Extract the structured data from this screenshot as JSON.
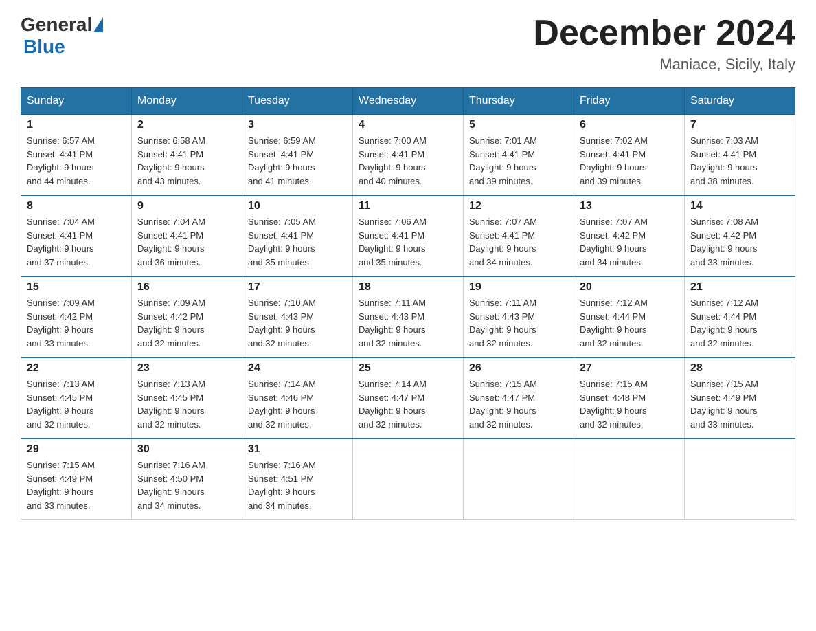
{
  "header": {
    "logo": {
      "general": "General",
      "blue": "Blue"
    },
    "month_title": "December 2024",
    "location": "Maniace, Sicily, Italy"
  },
  "weekdays": [
    "Sunday",
    "Monday",
    "Tuesday",
    "Wednesday",
    "Thursday",
    "Friday",
    "Saturday"
  ],
  "weeks": [
    [
      {
        "day": "1",
        "sunrise": "6:57 AM",
        "sunset": "4:41 PM",
        "daylight": "9 hours and 44 minutes."
      },
      {
        "day": "2",
        "sunrise": "6:58 AM",
        "sunset": "4:41 PM",
        "daylight": "9 hours and 43 minutes."
      },
      {
        "day": "3",
        "sunrise": "6:59 AM",
        "sunset": "4:41 PM",
        "daylight": "9 hours and 41 minutes."
      },
      {
        "day": "4",
        "sunrise": "7:00 AM",
        "sunset": "4:41 PM",
        "daylight": "9 hours and 40 minutes."
      },
      {
        "day": "5",
        "sunrise": "7:01 AM",
        "sunset": "4:41 PM",
        "daylight": "9 hours and 39 minutes."
      },
      {
        "day": "6",
        "sunrise": "7:02 AM",
        "sunset": "4:41 PM",
        "daylight": "9 hours and 39 minutes."
      },
      {
        "day": "7",
        "sunrise": "7:03 AM",
        "sunset": "4:41 PM",
        "daylight": "9 hours and 38 minutes."
      }
    ],
    [
      {
        "day": "8",
        "sunrise": "7:04 AM",
        "sunset": "4:41 PM",
        "daylight": "9 hours and 37 minutes."
      },
      {
        "day": "9",
        "sunrise": "7:04 AM",
        "sunset": "4:41 PM",
        "daylight": "9 hours and 36 minutes."
      },
      {
        "day": "10",
        "sunrise": "7:05 AM",
        "sunset": "4:41 PM",
        "daylight": "9 hours and 35 minutes."
      },
      {
        "day": "11",
        "sunrise": "7:06 AM",
        "sunset": "4:41 PM",
        "daylight": "9 hours and 35 minutes."
      },
      {
        "day": "12",
        "sunrise": "7:07 AM",
        "sunset": "4:41 PM",
        "daylight": "9 hours and 34 minutes."
      },
      {
        "day": "13",
        "sunrise": "7:07 AM",
        "sunset": "4:42 PM",
        "daylight": "9 hours and 34 minutes."
      },
      {
        "day": "14",
        "sunrise": "7:08 AM",
        "sunset": "4:42 PM",
        "daylight": "9 hours and 33 minutes."
      }
    ],
    [
      {
        "day": "15",
        "sunrise": "7:09 AM",
        "sunset": "4:42 PM",
        "daylight": "9 hours and 33 minutes."
      },
      {
        "day": "16",
        "sunrise": "7:09 AM",
        "sunset": "4:42 PM",
        "daylight": "9 hours and 32 minutes."
      },
      {
        "day": "17",
        "sunrise": "7:10 AM",
        "sunset": "4:43 PM",
        "daylight": "9 hours and 32 minutes."
      },
      {
        "day": "18",
        "sunrise": "7:11 AM",
        "sunset": "4:43 PM",
        "daylight": "9 hours and 32 minutes."
      },
      {
        "day": "19",
        "sunrise": "7:11 AM",
        "sunset": "4:43 PM",
        "daylight": "9 hours and 32 minutes."
      },
      {
        "day": "20",
        "sunrise": "7:12 AM",
        "sunset": "4:44 PM",
        "daylight": "9 hours and 32 minutes."
      },
      {
        "day": "21",
        "sunrise": "7:12 AM",
        "sunset": "4:44 PM",
        "daylight": "9 hours and 32 minutes."
      }
    ],
    [
      {
        "day": "22",
        "sunrise": "7:13 AM",
        "sunset": "4:45 PM",
        "daylight": "9 hours and 32 minutes."
      },
      {
        "day": "23",
        "sunrise": "7:13 AM",
        "sunset": "4:45 PM",
        "daylight": "9 hours and 32 minutes."
      },
      {
        "day": "24",
        "sunrise": "7:14 AM",
        "sunset": "4:46 PM",
        "daylight": "9 hours and 32 minutes."
      },
      {
        "day": "25",
        "sunrise": "7:14 AM",
        "sunset": "4:47 PM",
        "daylight": "9 hours and 32 minutes."
      },
      {
        "day": "26",
        "sunrise": "7:15 AM",
        "sunset": "4:47 PM",
        "daylight": "9 hours and 32 minutes."
      },
      {
        "day": "27",
        "sunrise": "7:15 AM",
        "sunset": "4:48 PM",
        "daylight": "9 hours and 32 minutes."
      },
      {
        "day": "28",
        "sunrise": "7:15 AM",
        "sunset": "4:49 PM",
        "daylight": "9 hours and 33 minutes."
      }
    ],
    [
      {
        "day": "29",
        "sunrise": "7:15 AM",
        "sunset": "4:49 PM",
        "daylight": "9 hours and 33 minutes."
      },
      {
        "day": "30",
        "sunrise": "7:16 AM",
        "sunset": "4:50 PM",
        "daylight": "9 hours and 34 minutes."
      },
      {
        "day": "31",
        "sunrise": "7:16 AM",
        "sunset": "4:51 PM",
        "daylight": "9 hours and 34 minutes."
      },
      null,
      null,
      null,
      null
    ]
  ],
  "labels": {
    "sunrise": "Sunrise:",
    "sunset": "Sunset:",
    "daylight": "Daylight:"
  }
}
